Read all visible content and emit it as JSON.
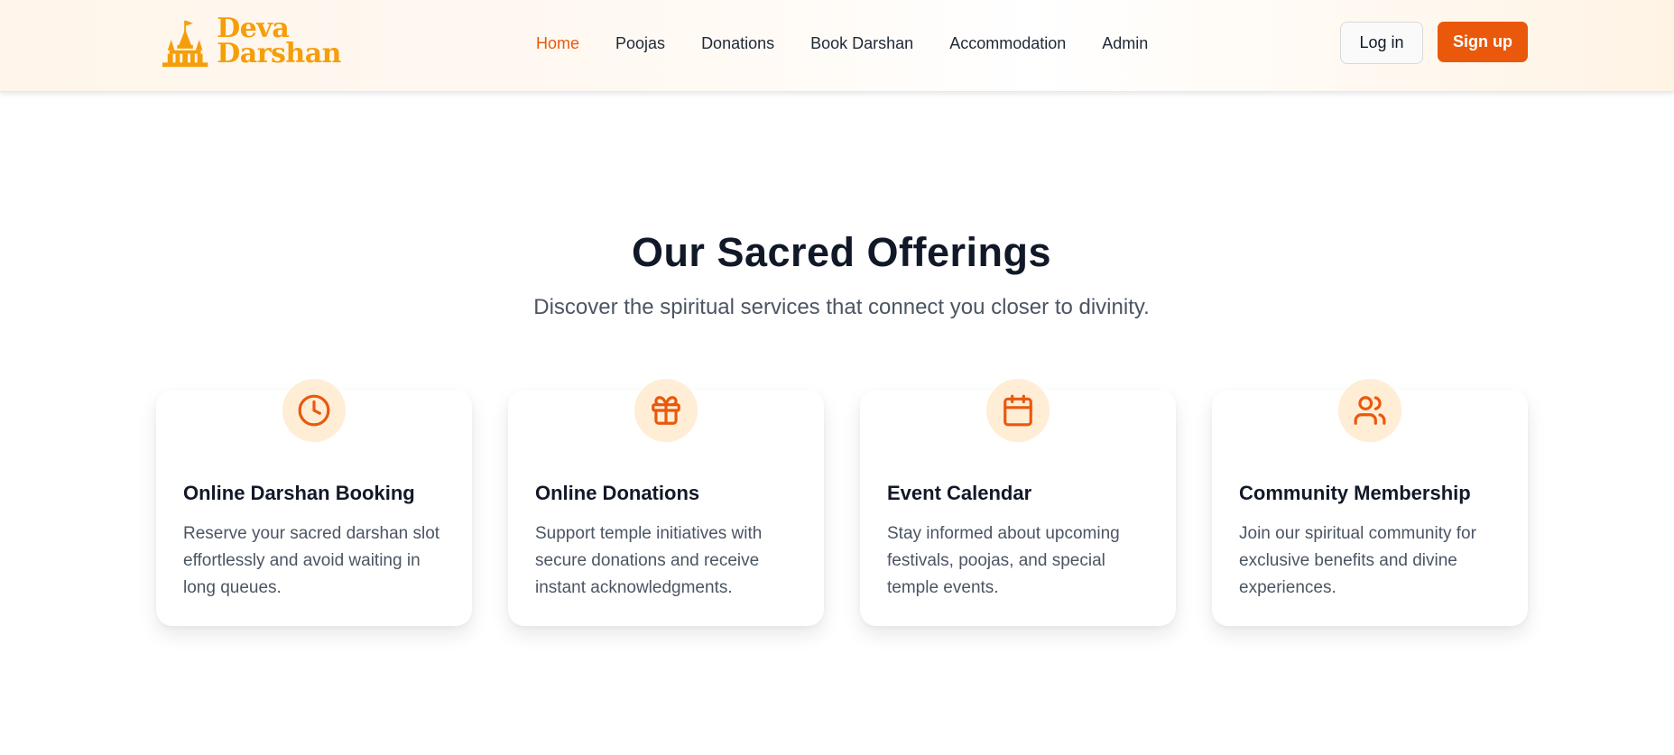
{
  "brand": {
    "line1": "Deva",
    "line2": "Darshan",
    "color": "#f59e0b"
  },
  "nav": {
    "items": [
      "Home",
      "Poojas",
      "Donations",
      "Book Darshan",
      "Accommodation",
      "Admin"
    ],
    "active": "Home",
    "active_color": "#ea580c"
  },
  "auth": {
    "login_label": "Log in",
    "signup_label": "Sign up",
    "signup_color": "#ea580c"
  },
  "offerings": {
    "title": "Our Sacred Offerings",
    "subtitle": "Discover the spiritual services that connect you closer to divinity.",
    "cards": [
      {
        "icon": "clock-icon",
        "title": "Online Darshan Booking",
        "description": "Reserve your sacred darshan slot effortlessly and avoid waiting in long queues."
      },
      {
        "icon": "gift-icon",
        "title": "Online Donations",
        "description": "Support temple initiatives with secure donations and receive instant acknowledgments."
      },
      {
        "icon": "calendar-icon",
        "title": "Event Calendar",
        "description": "Stay informed about upcoming festivals, poojas, and special temple events."
      },
      {
        "icon": "users-icon",
        "title": "Community Membership",
        "description": "Join our spiritual community for exclusive benefits and divine experiences."
      }
    ]
  }
}
